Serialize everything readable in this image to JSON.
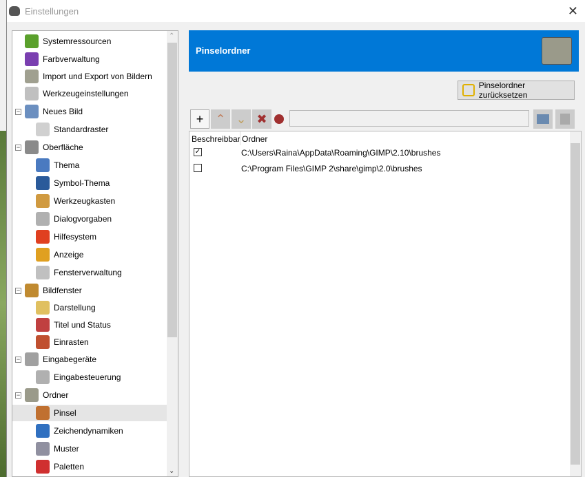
{
  "window": {
    "title": "Einstellungen",
    "close": "✕"
  },
  "tree": [
    {
      "label": "Systemressourcen",
      "level": 0,
      "color": "#5aa02c"
    },
    {
      "label": "Farbverwaltung",
      "level": 0,
      "color": "#7a3fb0"
    },
    {
      "label": "Import und Export von Bildern",
      "level": 0,
      "color": "#a0a090"
    },
    {
      "label": "Werkzeugeinstellungen",
      "level": 0,
      "color": "#c0c0c0"
    },
    {
      "label": "Neues Bild",
      "level": 0,
      "color": "#6b8fc0",
      "exp": "−"
    },
    {
      "label": "Standardraster",
      "level": 1,
      "color": "#d0d0d0"
    },
    {
      "label": "Oberfläche",
      "level": 0,
      "color": "#8a8a8a",
      "exp": "−"
    },
    {
      "label": "Thema",
      "level": 1,
      "color": "#4a7ac0"
    },
    {
      "label": "Symbol-Thema",
      "level": 1,
      "color": "#2a5a9a"
    },
    {
      "label": "Werkzeugkasten",
      "level": 1,
      "color": "#d09a40"
    },
    {
      "label": "Dialogvorgaben",
      "level": 1,
      "color": "#b0b0b0"
    },
    {
      "label": "Hilfesystem",
      "level": 1,
      "color": "#e04020"
    },
    {
      "label": "Anzeige",
      "level": 1,
      "color": "#e0a020"
    },
    {
      "label": "Fensterverwaltung",
      "level": 1,
      "color": "#c0c0c0"
    },
    {
      "label": "Bildfenster",
      "level": 0,
      "color": "#c08a30",
      "exp": "−"
    },
    {
      "label": "Darstellung",
      "level": 1,
      "color": "#e0c060"
    },
    {
      "label": "Titel und Status",
      "level": 1,
      "color": "#c04040"
    },
    {
      "label": "Einrasten",
      "level": 1,
      "color": "#c05030"
    },
    {
      "label": "Eingabegeräte",
      "level": 0,
      "color": "#a0a0a0",
      "exp": "−"
    },
    {
      "label": "Eingabesteuerung",
      "level": 1,
      "color": "#b0b0b0"
    },
    {
      "label": "Ordner",
      "level": 0,
      "color": "#9a9a8a",
      "exp": "−"
    },
    {
      "label": "Pinsel",
      "level": 1,
      "color": "#c07030",
      "selected": true
    },
    {
      "label": "Zeichendynamiken",
      "level": 1,
      "color": "#3070c0"
    },
    {
      "label": "Muster",
      "level": 1,
      "color": "#9090a0"
    },
    {
      "label": "Paletten",
      "level": 1,
      "color": "#d03030"
    }
  ],
  "header": {
    "title": "Pinselordner"
  },
  "reset_button": "Pinselordner zurücksetzen",
  "toolbar": {
    "add": "+",
    "up": "⌃",
    "down": "⌄",
    "delete": "✖",
    "path_value": ""
  },
  "list": {
    "col_writable": "Beschreibbar",
    "col_folder": "Ordner",
    "rows": [
      {
        "checked": true,
        "path": "C:\\Users\\Raina\\AppData\\Roaming\\GIMP\\2.10\\brushes"
      },
      {
        "checked": false,
        "path": "C:\\Program Files\\GIMP 2\\share\\gimp\\2.0\\brushes"
      }
    ]
  },
  "check_mark": "✓"
}
